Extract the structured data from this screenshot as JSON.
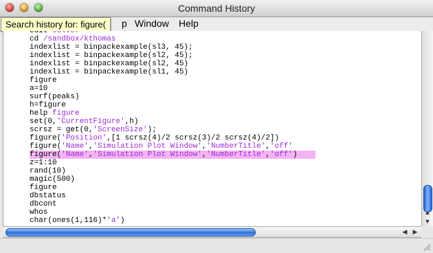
{
  "window": {
    "title": "Command History"
  },
  "menubar": {
    "partial_item": "p",
    "items": [
      "Window",
      "Help"
    ]
  },
  "tooltip": {
    "text": "Search history for: figure("
  },
  "history": [
    [
      [
        "edit ",
        ""
      ],
      [
        "solver",
        "kw"
      ]
    ],
    [
      [
        "cd ",
        ""
      ],
      [
        "/sandbox/kthomas",
        "kw"
      ]
    ],
    [
      [
        "indexlist = binpackexample(sl3, 45);",
        ""
      ]
    ],
    [
      [
        "indexlist = binpackexample(sl2, 45);",
        ""
      ]
    ],
    [
      [
        "indexlist = binpackexample(sl2, 45)",
        ""
      ]
    ],
    [
      [
        "indexlist = binpackexample(sl1, 45)",
        ""
      ]
    ],
    [
      [
        "figure",
        ""
      ]
    ],
    [
      [
        "a=10",
        ""
      ]
    ],
    [
      [
        "surf(peaks)",
        ""
      ]
    ],
    [
      [
        "h=figure",
        ""
      ]
    ],
    [
      [
        "help ",
        ""
      ],
      [
        "figure",
        "kw"
      ]
    ],
    [
      [
        "set(0,",
        ""
      ],
      [
        "'CurrentFigure'",
        "str"
      ],
      [
        ",h)",
        ""
      ]
    ],
    [
      [
        "scrsz = get(0,",
        ""
      ],
      [
        "'ScreenSize'",
        "str"
      ],
      [
        ");",
        ""
      ]
    ],
    [
      [
        "figure(",
        ""
      ],
      [
        "'Position'",
        "str"
      ],
      [
        ",[1 scrsz(4)/2 scrsz(3)/2 scrsz(4)/2])",
        ""
      ]
    ],
    [
      [
        "figure(",
        ""
      ],
      [
        "'Name'",
        "str"
      ],
      [
        ",",
        ""
      ],
      [
        "'Simulation Plot Window'",
        "str"
      ],
      [
        ",",
        ""
      ],
      [
        "'NumberTitle'",
        "str"
      ],
      [
        ",",
        ""
      ],
      [
        "'off'",
        "str"
      ]
    ],
    [
      [
        "figure(",
        ""
      ],
      [
        "'Name'",
        "str"
      ],
      [
        ",",
        ""
      ],
      [
        "'Simulation Plot Window'",
        "str"
      ],
      [
        ",",
        ""
      ],
      [
        "'NumberTitle'",
        "str"
      ],
      [
        ",",
        ""
      ],
      [
        "'off'",
        "str"
      ],
      [
        ")",
        ""
      ]
    ],
    [
      [
        "z=1:10",
        ""
      ]
    ],
    [
      [
        "rand(10)",
        ""
      ]
    ],
    [
      [
        "magic(500)",
        ""
      ]
    ],
    [
      [
        "figure",
        ""
      ]
    ],
    [
      [
        "dbstatus",
        ""
      ]
    ],
    [
      [
        "dbcont",
        ""
      ]
    ],
    [
      [
        "whos",
        ""
      ]
    ],
    [
      [
        "char(ones(1,116)*",
        ""
      ],
      [
        "'a'",
        "str"
      ],
      [
        ")",
        ""
      ]
    ]
  ],
  "selected_line_index": 15,
  "colors": {
    "keyword": "#9a2bd6",
    "highlight": "#f4b3f4"
  },
  "icons": {
    "scroll_up": "▲",
    "scroll_down": "▼",
    "scroll_left": "◀",
    "scroll_right": "▶"
  }
}
